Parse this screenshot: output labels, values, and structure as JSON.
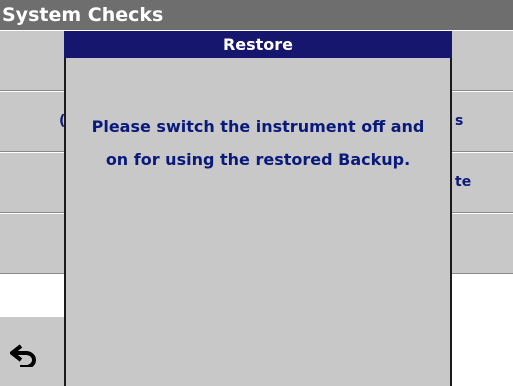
{
  "header": {
    "title": "System Checks"
  },
  "list": [
    {
      "left": "",
      "right": ""
    },
    {
      "left": "(",
      "right": "s"
    },
    {
      "left": "",
      "right": "te"
    },
    {
      "left": "",
      "right": ""
    }
  ],
  "dialog": {
    "title": "Restore",
    "message": "Please switch the instrument off and on for using the restored Backup."
  },
  "icons": {
    "back": "back-arrow-icon"
  },
  "colors": {
    "titlebar": "#6e6e6e",
    "dialog_title_bg": "#16166e",
    "text_blue": "#0a1a7a",
    "panel_gray": "#c8c8c8"
  }
}
